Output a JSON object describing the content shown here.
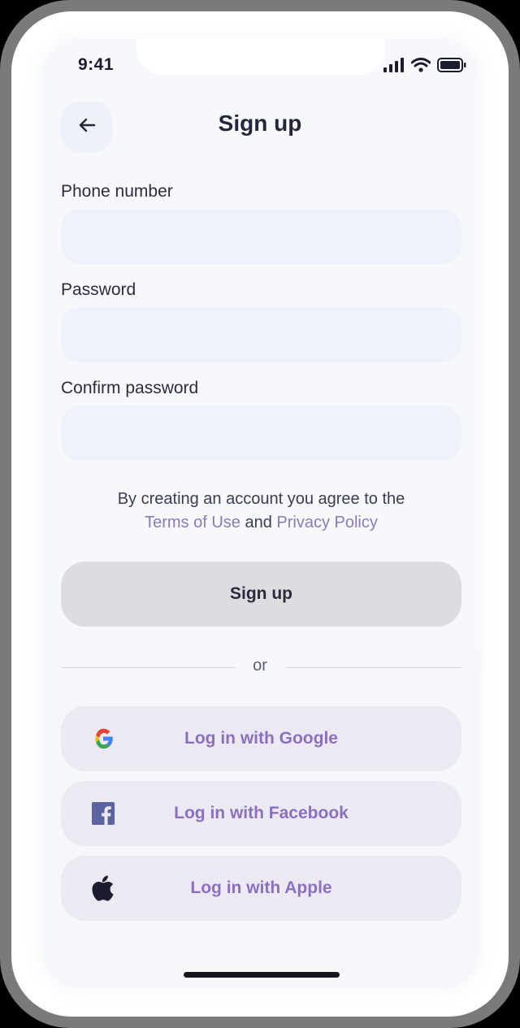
{
  "status_bar": {
    "time": "9:41",
    "icons": [
      "signal-icon",
      "wifi-icon",
      "battery-icon"
    ]
  },
  "header": {
    "back_icon": "arrow-left-icon",
    "title": "Sign up"
  },
  "form": {
    "phone": {
      "label": "Phone number",
      "value": "",
      "placeholder": ""
    },
    "password": {
      "label": "Password",
      "value": "",
      "placeholder": ""
    },
    "confirm_password": {
      "label": "Confirm password",
      "value": "",
      "placeholder": ""
    }
  },
  "terms": {
    "prefix": "By creating an account you agree to the",
    "terms_link": "Terms of Use",
    "connector": "and",
    "privacy_link": "Privacy Policy"
  },
  "signup_button": {
    "label": "Sign up"
  },
  "divider": {
    "label": "or"
  },
  "social": [
    {
      "label": "Log in with Google",
      "icon": "google-icon"
    },
    {
      "label": "Log in with Facebook",
      "icon": "facebook-icon"
    },
    {
      "label": "Log in with Apple",
      "icon": "apple-icon"
    }
  ],
  "colors": {
    "accent": "#8a70be",
    "link": "#8a7ab8",
    "input_bg": "#edf2fb",
    "social_bg": "#ece9f3",
    "button_disabled_bg": "#dcdce1",
    "text_dark": "#24273a"
  }
}
